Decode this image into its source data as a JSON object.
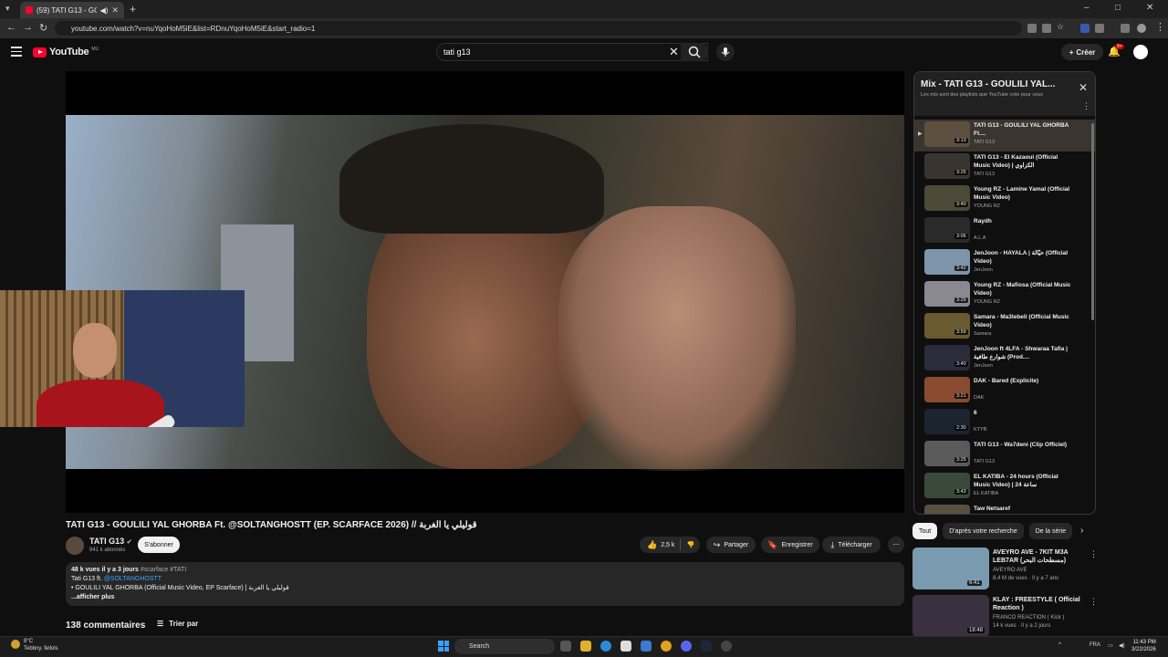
{
  "browser": {
    "tab_title": "(59) TATI G13 - GOULILI YA...",
    "url": "youtube.com/watch?v=nuYqoHoM5iE&list=RDnuYqoHoM5iE&start_radio=1"
  },
  "youtube": {
    "logo_text": "YouTube",
    "country_code": "MU",
    "search_value": "tati g13",
    "create_label": "Créer",
    "notif_count": "9+"
  },
  "video": {
    "title": "TATI G13 - GOULILI YAL GHORBA Ft. @SOLTANGHOSTT (EP. SCARFACE 2026) // قوليلي يا الغربة",
    "channel": "TATI G13",
    "subs": "941 k abonnés",
    "subscribe_label": "S'abonner",
    "likes": "2,5 k",
    "share_label": "Partager",
    "save_label": "Enregistrer",
    "download_label": "Télécharger",
    "views": "48 k vues",
    "age": "il y a 3 jours",
    "tags": "#scarface #TATI",
    "desc_line1_prefix": "Tati G13 ft.",
    "desc_line1_link": "@SOLTANGHOSTT",
    "desc_line2": "GOULILI YAL GHORBA (Official Music Video, EP Scarface) | قوليلي يا الغربة",
    "show_more": "...afficher plus",
    "comments_count": "138 commentaires",
    "sort_label": "Trier par"
  },
  "playlist": {
    "title": "Mix - TATI G13 - GOULILI YAL...",
    "subtitle": "Les mix sont des playlists que YouTube crée pour vous",
    "items": [
      {
        "title": "TATI G13 - GOULILI YAL GHORBA Ft....",
        "channel": "TATI G13",
        "duration": "3:13",
        "color": "#5d5040"
      },
      {
        "title": "TATI G13 - El Kazaoui (Official Music Video) | الكزاوي",
        "channel": "TATI G13",
        "duration": "3:25",
        "color": "#3a3430"
      },
      {
        "title": "Young RZ - Lamine Yamal (Official Music Video)",
        "channel": "YOUNG RZ",
        "duration": "3:40",
        "color": "#4c4a36"
      },
      {
        "title": "Raydh",
        "channel": "A.L.A",
        "duration": "3:06",
        "color": "#2a2a2a"
      },
      {
        "title": "JenJoon - HAYALA | حيّالة (Official Video)",
        "channel": "JenJoon",
        "duration": "3:42",
        "color": "#7d94aa"
      },
      {
        "title": "Young RZ - Mafiosa (Official Music Video)",
        "channel": "YOUNG RZ",
        "duration": "3:29",
        "color": "#8a8890"
      },
      {
        "title": "Samara - Ma3lebeli (Official Music Video)",
        "channel": "Samara",
        "duration": "3:59",
        "color": "#6a5a30"
      },
      {
        "title": "JenJoon ft 4LFA - Shwaraa Tafia | شوارع طافية (Prod....",
        "channel": "JenJoon",
        "duration": "3:40",
        "color": "#2a2c3c"
      },
      {
        "title": "DAK - Bared (Explicite)",
        "channel": "DAK",
        "duration": "3:21",
        "color": "#8a4a30"
      },
      {
        "title": "6",
        "channel": "KTYB",
        "duration": "2:30",
        "color": "#1c2430"
      },
      {
        "title": "TATI G13 - Wa7deni (Clip Officiel)",
        "channel": "TATI G13",
        "duration": "3:25",
        "color": "#5a5a5a"
      },
      {
        "title": "EL KATIBA - 24 hours (Official Music Video) | 24 ساعة",
        "channel": "EL KATIBA",
        "duration": "3:43",
        "color": "#3a4a3a"
      },
      {
        "title": "Taw Netsaref",
        "channel": "A.L.A",
        "duration": "",
        "color": "#5a5040"
      }
    ]
  },
  "chips": [
    "Tout",
    "D'après votre recherche",
    "De la série"
  ],
  "recommendations": [
    {
      "title": "AVEYRO AVE - 7KIT M3A LEB7AR (مسطحات البحر)",
      "channel": "AVEYRO AVE",
      "meta": "8,4 M de vues · Il y a 7 ans",
      "duration": "6:41",
      "color": "#7a9ab0"
    },
    {
      "title": "KLAY : FREESTYLE ( Official Reaction )",
      "channel": "FRANCO REACTION ( Kick )",
      "meta": "14 k vues · Il y a 2 jours",
      "duration": "18:48",
      "color": "#3a3040"
    }
  ],
  "taskbar": {
    "temp": "8°C",
    "weather_desc": "Tebbny. fellols",
    "search_label": "Search",
    "lang": "FRA",
    "time": "11:43 PM",
    "date": "3/22/2026"
  }
}
